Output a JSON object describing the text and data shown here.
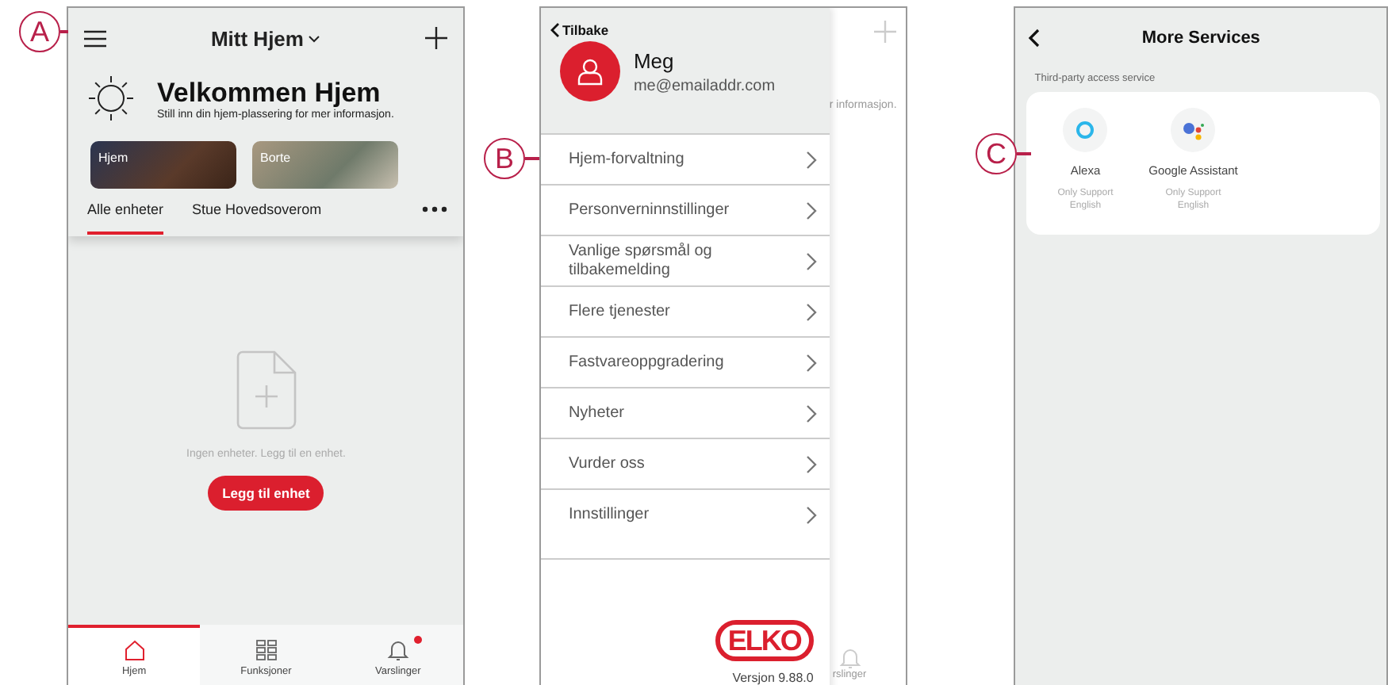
{
  "callouts": [
    {
      "label": "A"
    },
    {
      "label": "B"
    },
    {
      "label": "C"
    }
  ],
  "home": {
    "title": "Mitt Hjem",
    "welcome": "Velkommen Hjem",
    "subtitle": "Still inn din hjem-plassering for mer informasjon.",
    "scenes": [
      {
        "label": "Hjem"
      },
      {
        "label": "Borte"
      }
    ],
    "rooms": [
      {
        "label": "Alle enheter",
        "selected": true
      },
      {
        "label": "Stue Hovedsoverom",
        "selected": false
      }
    ],
    "empty_text": "Ingen enheter. Legg til en enhet.",
    "add_button": "Legg til enhet",
    "nav": [
      {
        "label": "Hjem",
        "selected": true,
        "kind": "home",
        "badge": false
      },
      {
        "label": "Funksjoner",
        "selected": false,
        "kind": "grid",
        "badge": false
      },
      {
        "label": "Varslinger",
        "selected": false,
        "kind": "bell",
        "badge": true
      }
    ]
  },
  "menu": {
    "back": "Tilbake",
    "name": "Meg",
    "email": "me@emailaddr.com",
    "items": [
      {
        "label": "Hjem-forvaltning"
      },
      {
        "label": "Personverninnstillinger"
      },
      {
        "label": "Vanlige spørsmål og tilbakemelding"
      },
      {
        "label": "Flere tjenester"
      },
      {
        "label": "Fastvareoppgradering"
      },
      {
        "label": "Nyheter"
      },
      {
        "label": "Vurder oss"
      },
      {
        "label": "Innstillinger"
      }
    ],
    "logo": "ELKO",
    "version": "Versjon 9.88.0",
    "behind_text": "r informasjon.",
    "behind_nav": "rslinger"
  },
  "services": {
    "title": "More Services",
    "section": "Third-party access service",
    "items": [
      {
        "name": "Alexa",
        "note": "Only Support English",
        "kind": "alexa"
      },
      {
        "name": "Google Assistant",
        "note": "Only Support English",
        "kind": "google"
      }
    ]
  }
}
